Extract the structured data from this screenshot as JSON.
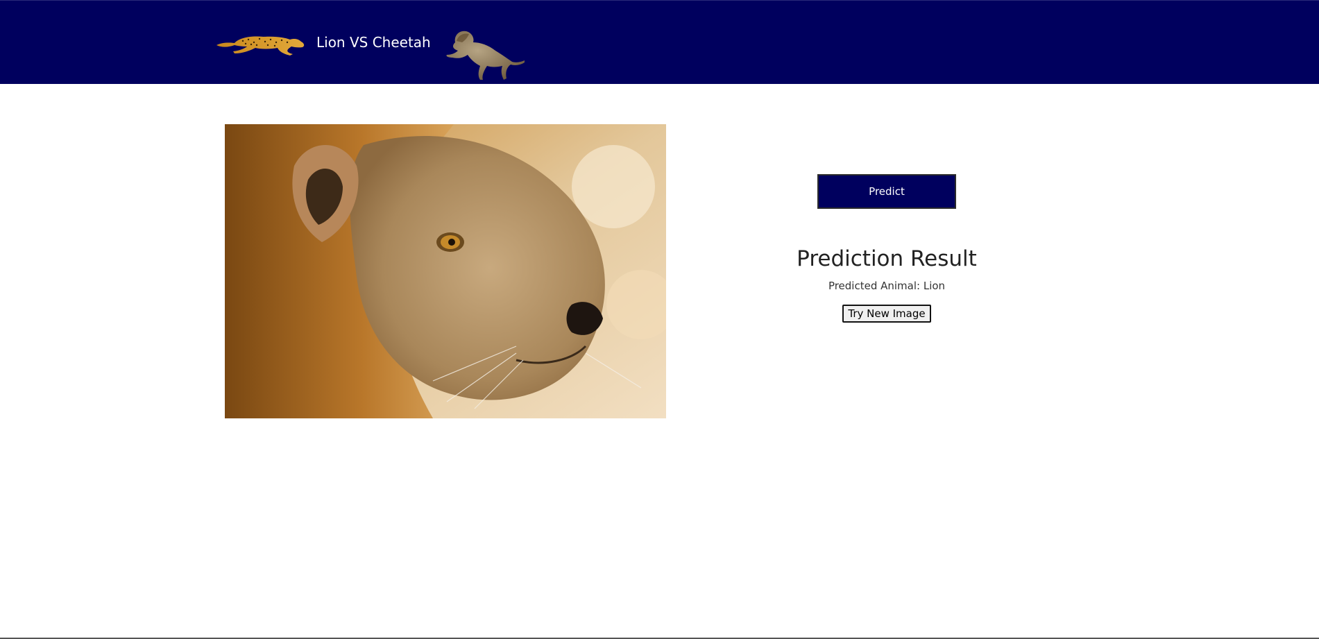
{
  "header": {
    "title": "Lion VS Cheetah",
    "bg_color": "#00005e",
    "logo_left_icon": "cheetah-running-icon",
    "logo_right_icon": "lion-leaping-icon"
  },
  "main": {
    "image_subject": "lion-face-photo",
    "predict_label": "Predict",
    "result_heading": "Prediction Result",
    "result_text": "Predicted Animal: Lion",
    "try_again_label": "Try New Image"
  }
}
